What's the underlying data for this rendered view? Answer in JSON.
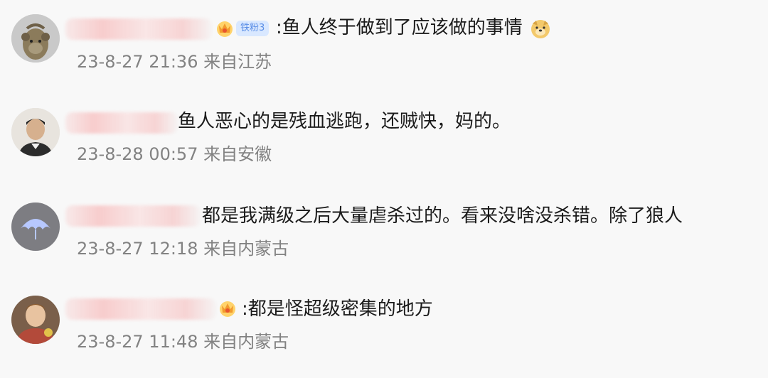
{
  "comments": [
    {
      "text": ":鱼人终于做到了应该做的事情",
      "fan_badge": "铁粉3",
      "date": "23-8-27 21:36",
      "location": "来自江苏"
    },
    {
      "text": "鱼人恶心的是残血逃跑，还贼快，妈的。",
      "date": "23-8-28 00:57",
      "location": "来自安徽"
    },
    {
      "text": "都是我满级之后大量虐杀过的。看来没啥没杀错。除了狼人",
      "date": "23-8-27 12:18",
      "location": "来自内蒙古"
    },
    {
      "text": ":都是怪超级密集的地方",
      "date": "23-8-27 11:48",
      "location": "来自内蒙古"
    }
  ],
  "colors": {
    "background": "#f8f8f8",
    "text": "#1b1b1b",
    "meta": "#828282",
    "fan_badge_bg": "#d9e8ff",
    "fan_badge_text": "#5a8ee6"
  },
  "icons": {
    "crown_badge": "crown-badge-icon",
    "dog_emoji": "doge-emoji-icon"
  }
}
